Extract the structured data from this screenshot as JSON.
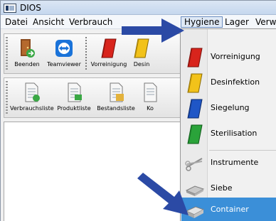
{
  "window": {
    "title": "DIOS"
  },
  "menubar": {
    "items": [
      "Datei",
      "Ansicht",
      "Verbrauch",
      "Hygiene",
      "Lager",
      "Verw"
    ],
    "active": "Hygiene"
  },
  "toolbar_row1": {
    "buttons": [
      {
        "label": "Beenden",
        "icon": "exit-door-icon"
      },
      {
        "label": "Teamviewer",
        "icon": "teamviewer-icon"
      },
      {
        "label": "Vorreinigung",
        "icon": "red-book-icon"
      },
      {
        "label": "Desin",
        "icon": "yellow-book-icon"
      }
    ]
  },
  "toolbar_row2": {
    "buttons": [
      {
        "label": "Verbrauchsliste",
        "icon": "list-document-icon"
      },
      {
        "label": "Produktliste",
        "icon": "list-document-icon"
      },
      {
        "label": "Bestandsliste",
        "icon": "list-document-icon"
      },
      {
        "label": "Ko",
        "icon": "list-document-icon"
      }
    ]
  },
  "hygiene_menu": {
    "items": [
      {
        "label": "Vorreinigung",
        "icon": "red-book-icon",
        "color": "#d8241c"
      },
      {
        "label": "Desinfektion",
        "icon": "yellow-book-icon",
        "color": "#f2c21a"
      },
      {
        "label": "Siegelung",
        "icon": "blue-book-icon",
        "color": "#1f56c6"
      },
      {
        "label": "Sterilisation",
        "icon": "green-book-icon",
        "color": "#2aa33a"
      },
      {
        "label": "Instrumente",
        "icon": "scissors-instruments-icon"
      },
      {
        "label": "Siebe",
        "icon": "tray-icon"
      },
      {
        "label": "Container",
        "icon": "container-icon"
      }
    ],
    "highlighted": "Container"
  },
  "colors": {
    "highlight": "#3b8fd8",
    "arrow": "#2b4aa5"
  }
}
